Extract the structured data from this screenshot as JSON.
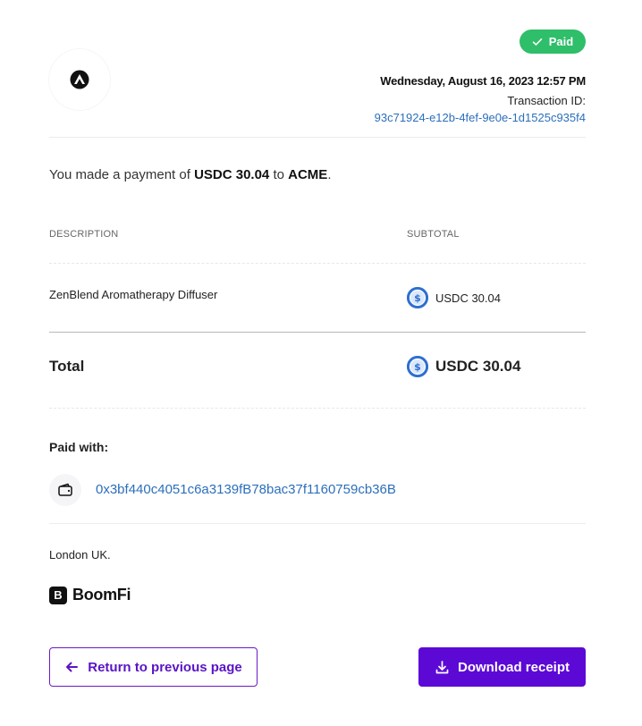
{
  "status_badge": {
    "label": "Paid",
    "color": "#2fbe6a",
    "icon": "check-icon"
  },
  "merchant": {
    "logo_icon": "merchant-logo-icon"
  },
  "transaction": {
    "date": "Wednesday, August 16, 2023 12:57 PM",
    "id_label": "Transaction ID:",
    "id": "93c71924-e12b-4fef-9e0e-1d1525c935f4"
  },
  "summary": {
    "prefix": "You made a payment of ",
    "amount": "USDC 30.04",
    "middle": " to ",
    "merchant": "ACME",
    "suffix": "."
  },
  "table": {
    "headers": [
      "DESCRIPTION",
      "SUBTOTAL"
    ],
    "rows": [
      {
        "description": "ZenBlend Aromatherapy Diffuser",
        "subtotal": "USDC 30.04",
        "currency_icon": "usdc-icon"
      }
    ],
    "total_label": "Total",
    "total_amount": "USDC 30.04"
  },
  "payment_method": {
    "label": "Paid with:",
    "wallet_icon": "wallet-icon",
    "address": "0x3bf440c4051c6a3139fB78bac37f1160759cb36B"
  },
  "location": "London UK.",
  "brand": {
    "mark": "B",
    "name": "BoomFi"
  },
  "actions": {
    "return_label": "Return to previous page",
    "download_label": "Download receipt"
  },
  "colors": {
    "accent": "#5c09d6",
    "link": "#2c6fbb",
    "success": "#2fbe6a",
    "usdc": "#2e6fd0"
  }
}
